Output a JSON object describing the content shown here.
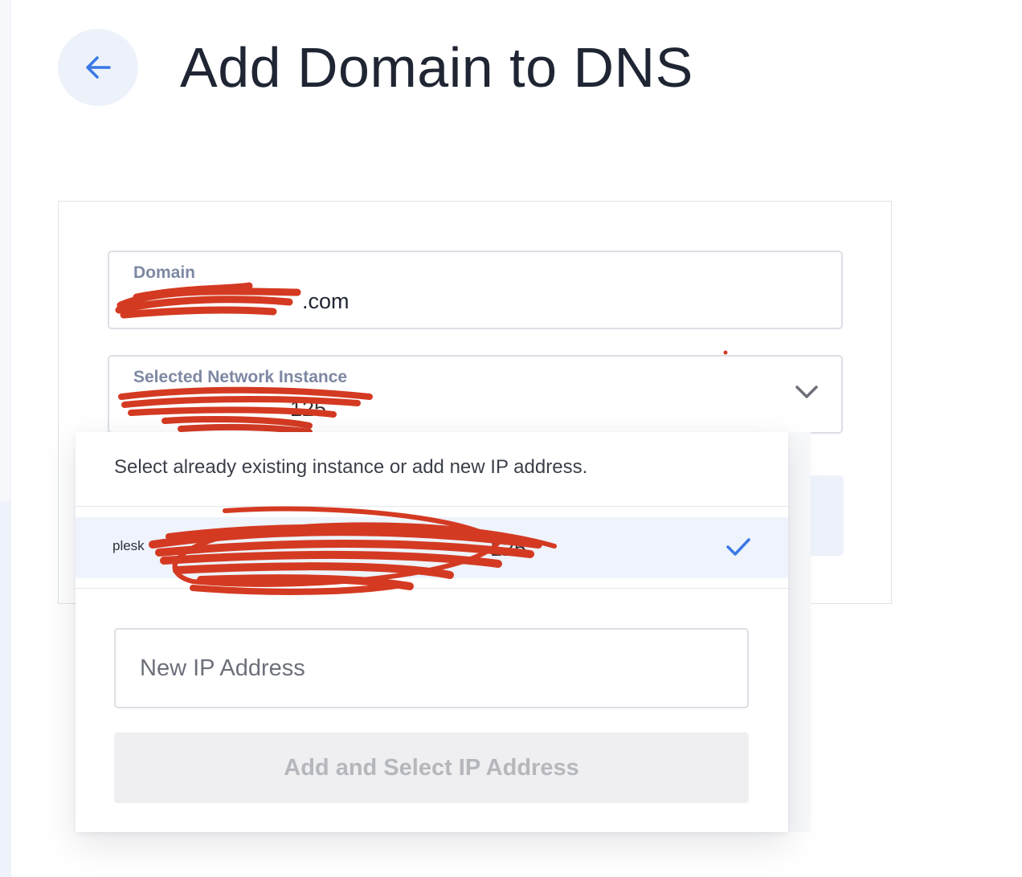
{
  "page": {
    "title": "Add Domain to DNS",
    "back_icon": "arrow-left-icon"
  },
  "form": {
    "domain": {
      "label": "Domain",
      "value": ".com"
    },
    "network_instance": {
      "label": "Selected Network Instance",
      "value": "125",
      "chevron_icon": "chevron-down-icon"
    }
  },
  "dropdown": {
    "hint": "Select already existing instance or add new IP address.",
    "options": [
      {
        "label": "plesk",
        "trailing": "125",
        "selected": true,
        "check_icon": "check-icon"
      }
    ],
    "new_ip": {
      "placeholder": "New IP Address",
      "value": ""
    },
    "add_button_label": "Add and Select IP Address",
    "add_button_disabled": true
  },
  "colors": {
    "accent": "#3a78e6",
    "back_button_bg": "#edf2fa",
    "selected_row_bg": "#eef3fc",
    "label_color": "#7d88a3",
    "redaction": "#d43a22"
  }
}
